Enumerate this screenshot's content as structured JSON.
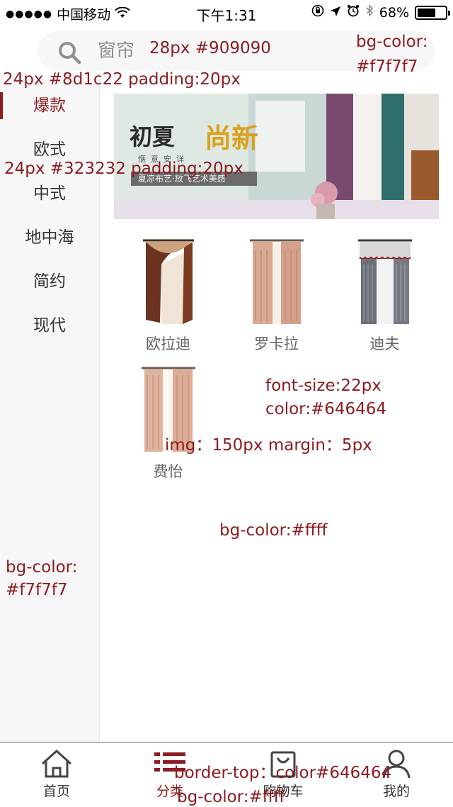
{
  "status_bar": {
    "carrier": "中国移动",
    "time": "下午1:31",
    "battery": "68%",
    "battery_level": 0.68
  },
  "search": {
    "placeholder": "窗帘"
  },
  "sidebar": {
    "items": [
      {
        "label": "爆款",
        "active": true
      },
      {
        "label": "欧式"
      },
      {
        "label": "中式"
      },
      {
        "label": "地中海"
      },
      {
        "label": "简约"
      },
      {
        "label": "现代"
      }
    ]
  },
  "banner": {
    "title_part1": "初夏",
    "title_part2": "尚新",
    "subtitle": "惬意安详",
    "strip_text": "夏凉布艺·放飞艺术美感"
  },
  "products": [
    {
      "name": "欧拉迪",
      "icon": "curtain-brown-icon"
    },
    {
      "name": "罗卡拉",
      "icon": "curtain-pink-icon"
    },
    {
      "name": "迪夫",
      "icon": "curtain-grey-icon"
    },
    {
      "name": "费怡",
      "icon": "curtain-peach-icon"
    }
  ],
  "annotations": {
    "search_style": "28px #909090",
    "search_bg_1": "bg-color:",
    "search_bg_2": "#f7f7f7",
    "active_style": "24px #8d1c22  padding:20px",
    "item_style": "24px #323232  padding:20px",
    "font_size": "font-size:22px",
    "font_color": "color:#646464",
    "img_style": "img：150px margin：5px",
    "main_bg": "bg-color:#ffff",
    "side_bg_1": "bg-color:",
    "side_bg_2": "#f7f7f7",
    "tab_border": "border-top：color#646464",
    "tab_bg": "bg-color:#ffff"
  },
  "tab_bar": {
    "tabs": [
      {
        "label": "首页",
        "icon": "home-icon"
      },
      {
        "label": "分类",
        "icon": "category-icon",
        "active": true
      },
      {
        "label": "购物车",
        "icon": "cart-icon"
      },
      {
        "label": "我的",
        "icon": "user-icon"
      }
    ]
  },
  "colors": {
    "accent": "#8d1c22",
    "text": "#323232",
    "muted": "#646464",
    "placeholder": "#909090",
    "panel_bg": "#f7f7f7"
  }
}
